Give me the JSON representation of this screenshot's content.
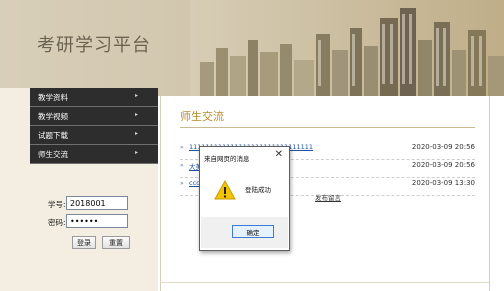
{
  "site": {
    "title": "考研学习平台"
  },
  "menu": {
    "items": [
      {
        "label": "教学资料",
        "arrow": "▸"
      },
      {
        "label": "教学视频",
        "arrow": "▸"
      },
      {
        "label": "试题下载",
        "arrow": "▸"
      },
      {
        "label": "师生交流",
        "arrow": "▸"
      }
    ]
  },
  "login": {
    "student_id_label": "学号:",
    "student_id_value": "2018001",
    "password_label": "密码:",
    "password_value": "••••••",
    "login_button": "登录",
    "reset_button": "重置"
  },
  "main": {
    "section_title": "师生交流",
    "posts": [
      {
        "title": "111111111111111111111111111111",
        "date": "2020-03-09 20:56"
      },
      {
        "title": "大美",
        "date": "2020-03-09 20:56"
      },
      {
        "title": "ccc",
        "date": "2020-03-09 13:30"
      }
    ],
    "publish_link": "发布留言"
  },
  "dialog": {
    "title": "来自网页的消息",
    "close": "✕",
    "message": "登陆成功",
    "ok_button": "确定",
    "icon": "warning-icon"
  },
  "colors": {
    "header_bg": "#cfc3a8",
    "menu_bg": "#2d2d2d",
    "section_title": "#b58a2e",
    "link": "#2050a0"
  }
}
